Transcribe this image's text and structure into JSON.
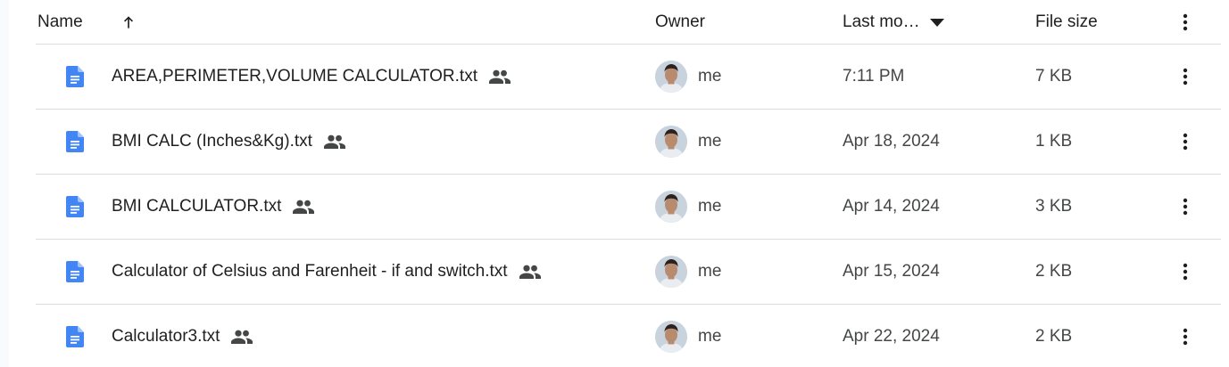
{
  "header": {
    "name_label": "Name",
    "sort_icon": "arrow-up-icon",
    "owner_label": "Owner",
    "modified_label": "Last mo…",
    "modified_icon": "caret-down-icon",
    "size_label": "File size",
    "menu_icon": "more-vert-icon"
  },
  "files": [
    {
      "name": "AREA,PERIMETER,VOLUME CALCULATOR.txt",
      "owner": "me",
      "modified": "7:11 PM",
      "size": "7 KB"
    },
    {
      "name": "BMI CALC (Inches&Kg).txt",
      "owner": "me",
      "modified": "Apr 18, 2024",
      "size": "1 KB"
    },
    {
      "name": "BMI CALCULATOR.txt",
      "owner": "me",
      "modified": "Apr 14, 2024",
      "size": "3 KB"
    },
    {
      "name": "Calculator of Celsius and Farenheit - if and switch.txt",
      "owner": "me",
      "modified": "Apr 15, 2024",
      "size": "2 KB"
    },
    {
      "name": "Calculator3.txt",
      "owner": "me",
      "modified": "Apr 22, 2024",
      "size": "2 KB"
    }
  ],
  "colors": {
    "doc_icon": "#4285f4",
    "divider": "#dadce0",
    "text": "#1f1f1f",
    "secondary_text": "#444746"
  }
}
